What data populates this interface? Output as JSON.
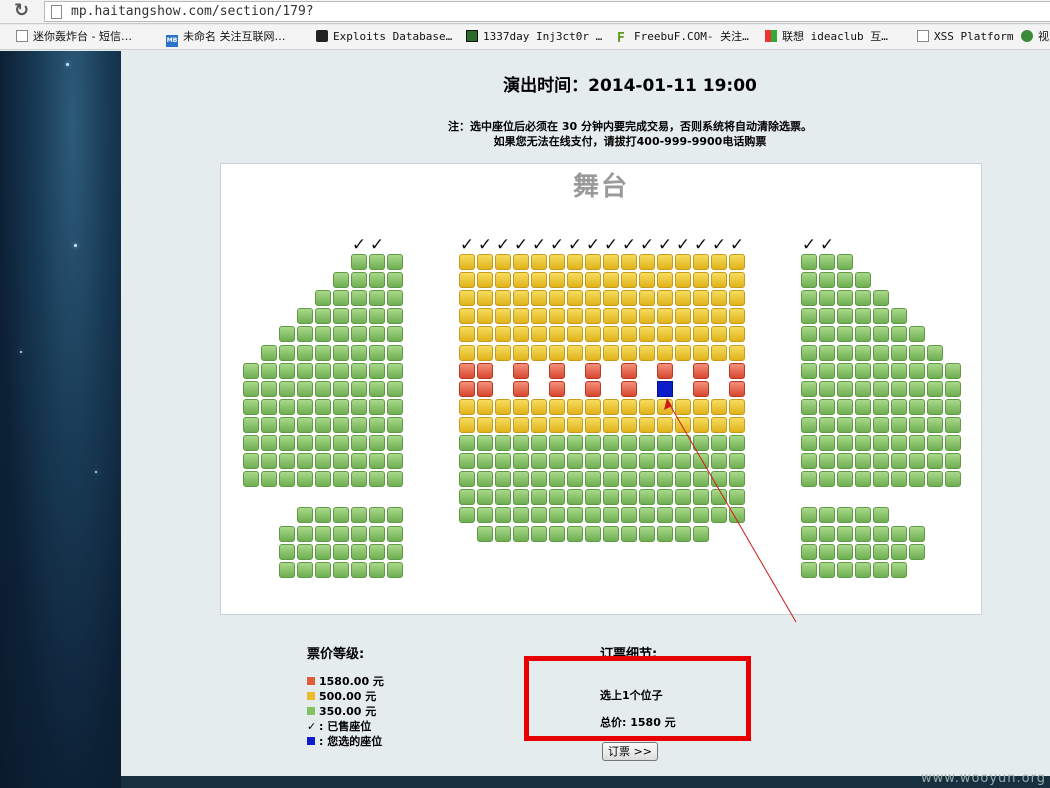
{
  "browser": {
    "url": "mp.haitangshow.com/section/179?",
    "bookmarks": [
      {
        "label": "迷你轰炸台 - 短信…",
        "icon": "page-icon"
      },
      {
        "label": "未命名 关注互联网…",
        "icon": "mb-logo-icon"
      },
      {
        "label": "Exploits Database…",
        "icon": "exploit-db-icon"
      },
      {
        "label": "1337day Inj3ct0r …",
        "icon": "1337day-icon"
      },
      {
        "label": "FreebuF.COM- 关注…",
        "icon": "freebuf-icon"
      },
      {
        "label": "联想 ideaclub 互…",
        "icon": "lenovo-grid-icon"
      },
      {
        "label": "XSS Platform",
        "icon": "page-icon"
      },
      {
        "label": "视",
        "icon": "avatar-icon"
      }
    ]
  },
  "page": {
    "show_time": "演出时间：2014-01-11 19:00",
    "note_line1": "注：选中座位后必须在 30 分钟内要完成交易，否则系统将自动清除选票。",
    "note_line2": "如果您无法在线支付，请拔打400-999-9900电话购票",
    "stage_label": "舞台",
    "legend_title": "票价等级:",
    "legend": [
      {
        "label": "1580.00 元",
        "color": "#e05a3c"
      },
      {
        "label": "500.00 元",
        "color": "#e8bd2a"
      },
      {
        "label": "350.00 元",
        "color": "#82c262"
      },
      {
        "label": ": 已售座位",
        "symbol": "✓"
      },
      {
        "label": ": 您选的座位",
        "color": "#0b1ec9"
      }
    ],
    "order_title": "订票细节:",
    "selected_text": "选上1个位子",
    "total_text": "总价: 1580 元",
    "order_button": "订票 >>",
    "watermark": "www.wooyun.org"
  },
  "seatmap": {
    "colors": {
      "g": "350.00 元",
      "y": "500.00 元",
      "r": "1580.00 元",
      "b": "selected",
      "sold": "✓"
    },
    "sold_symbol": "✓",
    "left_section": {
      "sold_row": "......XX",
      "rows": [
        "......GGG",
        ".....GGGG",
        "....GGGGG",
        "...GGGGGG",
        "..GGGGGGG",
        ".GGGGGGGG",
        "GGGGGGGGG",
        "GGGGGGGGG",
        "GGGGGGGGG",
        "GGGGGGGGG",
        "GGGGGGGGG",
        "GGGGGGGGG",
        "GGGGGGGGG",
        ".........",
        "...GGGGGG",
        "..GGGGGGG",
        "..GGGGGGG",
        "..GGGGGGG"
      ]
    },
    "center_section": {
      "sold_row": "XXXXXXXXXXXXXXXX",
      "rows": [
        "YYYYYYYYYYYYYYYY",
        "YYYYYYYYYYYYYYYY",
        "YYYYYYYYYYYYYYYY",
        "YYYYYYYYYYYYYYYY",
        "YYYYYYYYYYYYYYYY",
        "YYYYYYYYYYYYYYYY",
        "RR.R.R.R.R.R.R.R",
        "RR.R.R.R.R.B.R.R",
        "YYYYYYYYYYYYYYYY",
        "YYYYYYYYYYYYYYYY",
        "GGGGGGGGGGGGGGGG",
        "GGGGGGGGGGGGGGGG",
        "GGGGGGGGGGGGGGGG",
        "GGGGGGGGGGGGGGGG",
        "GGGGGGGGGGGGGGGG",
        ".GGGGGGGGGGGGG.."
      ]
    },
    "right_section": {
      "sold_row": "XX......",
      "rows": [
        "GGG......",
        "GGGG.....",
        "GGGGG....",
        "GGGGGG...",
        "GGGGGGG..",
        "GGGGGGGG.",
        "GGGGGGGGG",
        "GGGGGGGGG",
        "GGGGGGGGG",
        "GGGGGGGGG",
        "GGGGGGGGG",
        "GGGGGGGGG",
        "GGGGGGGGG",
        ".........",
        "GGGGG....",
        "GGGGGGG..",
        "GGGGGGG..",
        "GGGGGG..."
      ]
    }
  }
}
